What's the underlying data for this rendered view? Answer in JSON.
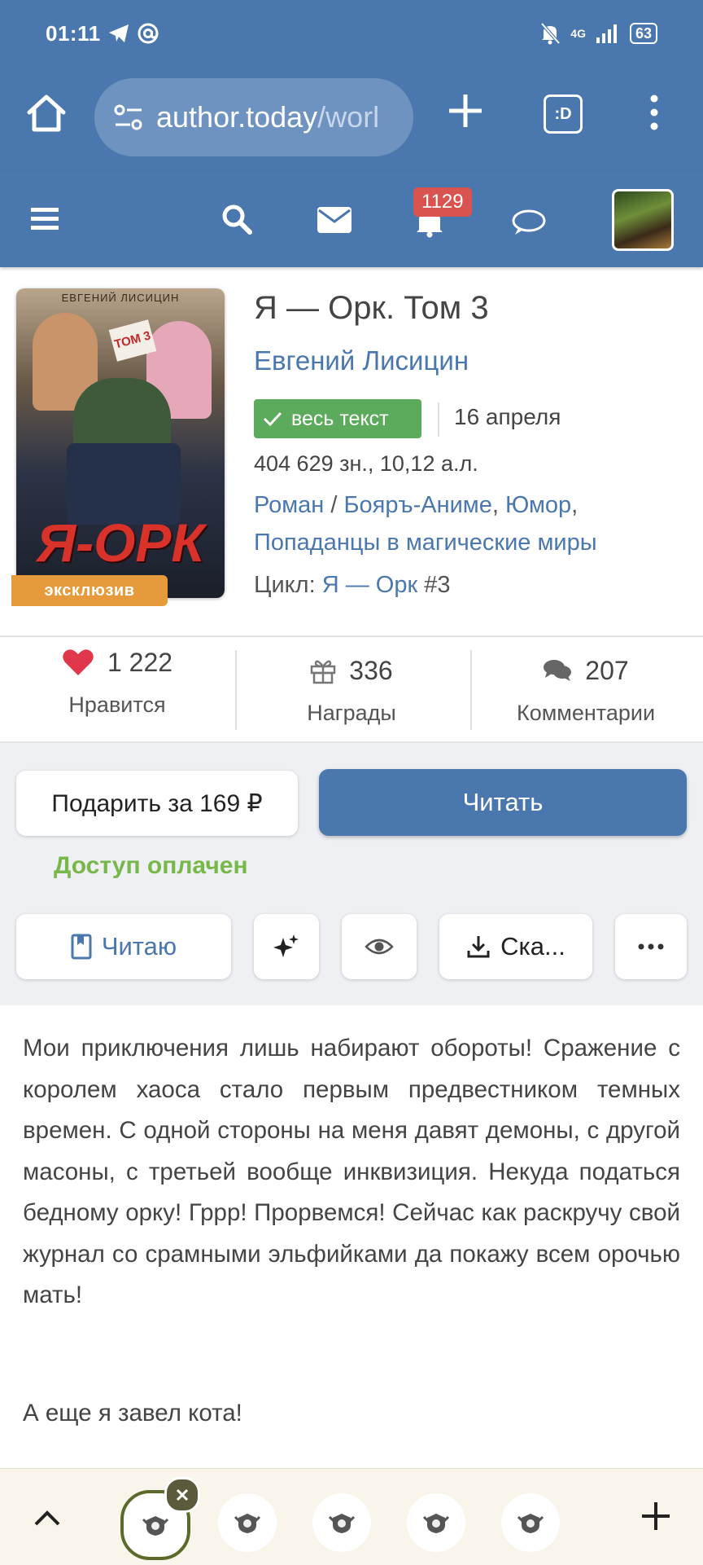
{
  "status_bar": {
    "time": "01:11",
    "battery": "63",
    "network": "4G"
  },
  "browser": {
    "url_host": "author.today",
    "url_path": "/worl",
    "tabs_label": ":D"
  },
  "site_header": {
    "notifications_count": "1129"
  },
  "book": {
    "cover_author": "ЕВГЕНИЙ ЛИСИЦИН",
    "cover_title": "Я-ОРК",
    "cover_volume": "ТОМ 3",
    "exclusive_label": "эксклюзив",
    "title": "Я — Орк. Том 3",
    "author": "Евгений Лисицин",
    "status": "весь текст",
    "date": "16 апреля",
    "size": "404 629 зн., 10,12 а.л.",
    "genre_main": "Роман",
    "genre_sep": " / ",
    "genre_2": "Бояръ-Аниме",
    "genre_comma1": ", ",
    "genre_3": "Юмор",
    "genre_comma2": ",",
    "genre_4": "Попаданцы в магические миры",
    "cycle_label": "Цикл: ",
    "cycle_name": "Я — Орк",
    "cycle_num": " #3"
  },
  "stats": {
    "likes": {
      "value": "1 222",
      "label": "Нравится"
    },
    "awards": {
      "value": "336",
      "label": "Награды"
    },
    "comments": {
      "value": "207",
      "label": "Комментарии"
    }
  },
  "actions": {
    "gift_label": "Подарить за 169 ₽",
    "read_label": "Читать",
    "access_text": "Доступ оплачен",
    "reading_label": "Читаю",
    "download_label": "Ска..."
  },
  "description": {
    "text": "Мои приключения лишь набирают обороты! Сражение с королем хаоса стало первым предвестником темных времен. С одной стороны на меня давят демоны, с другой масоны, с третьей вообще инквизиция. Некуда податься бедному орку! Гррр! Прорвемся! Сейчас как раскручу свой журнал со срамными эльфийками да покажу всем орочью мать!",
    "extra": "А еще я завел кота!"
  },
  "colors": {
    "brand": "#4a77ad",
    "success": "#5cab5c",
    "access": "#78b84a",
    "badge": "#d9534f",
    "exclusive": "#e79a3b"
  }
}
